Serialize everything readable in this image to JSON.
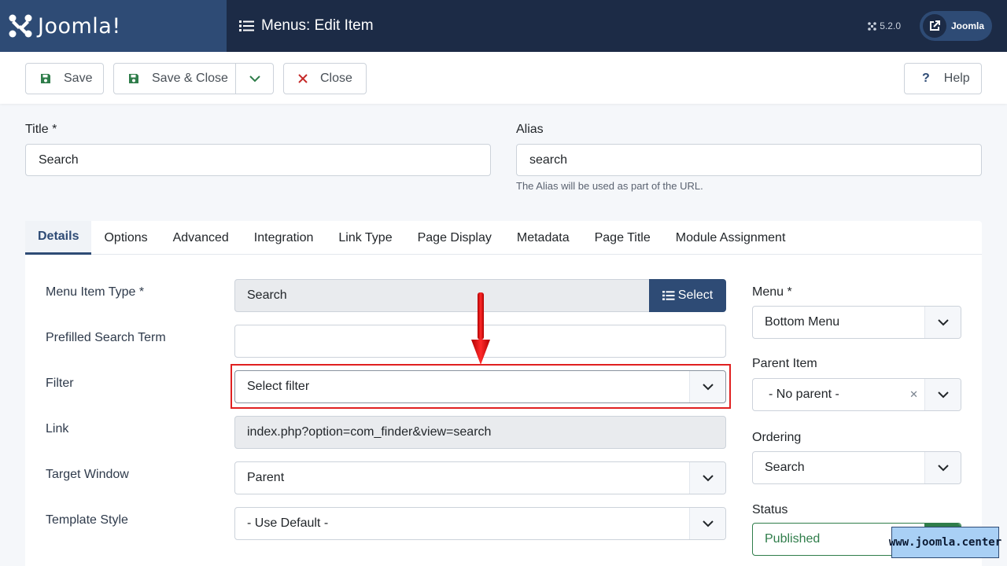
{
  "header": {
    "logo_text": "Joomla!",
    "page_title": "Menus: Edit Item",
    "version": "5.2.0",
    "user_label": "Joomla"
  },
  "toolbar": {
    "save_label": "Save",
    "save_close_label": "Save & Close",
    "close_label": "Close",
    "help_label": "Help"
  },
  "form": {
    "title_label": "Title *",
    "title_value": "Search",
    "alias_label": "Alias",
    "alias_value": "search",
    "alias_hint": "The Alias will be used as part of the URL."
  },
  "tabs": [
    "Details",
    "Options",
    "Advanced",
    "Integration",
    "Link Type",
    "Page Display",
    "Metadata",
    "Page Title",
    "Module Assignment"
  ],
  "details": {
    "menu_item_type_label": "Menu Item Type *",
    "menu_item_type_value": "Search",
    "select_button": "Select",
    "prefilled_label": "Prefilled Search Term",
    "prefilled_value": "",
    "filter_label": "Filter",
    "filter_value": "Select filter",
    "link_label": "Link",
    "link_value": "index.php?option=com_finder&view=search",
    "target_label": "Target Window",
    "target_value": "Parent",
    "template_label": "Template Style",
    "template_value": "- Use Default -"
  },
  "sidebar": {
    "menu_label": "Menu *",
    "menu_value": "Bottom Menu",
    "parent_label": "Parent Item",
    "parent_value": "- No parent -",
    "ordering_label": "Ordering",
    "ordering_value": "Search",
    "status_label": "Status",
    "status_value": "Published"
  },
  "watermark": "www.joomla.center",
  "colors": {
    "header_bg": "#1c2b46",
    "brand": "#2e4b75",
    "highlight": "#e02020",
    "published": "#2f7d4a"
  }
}
